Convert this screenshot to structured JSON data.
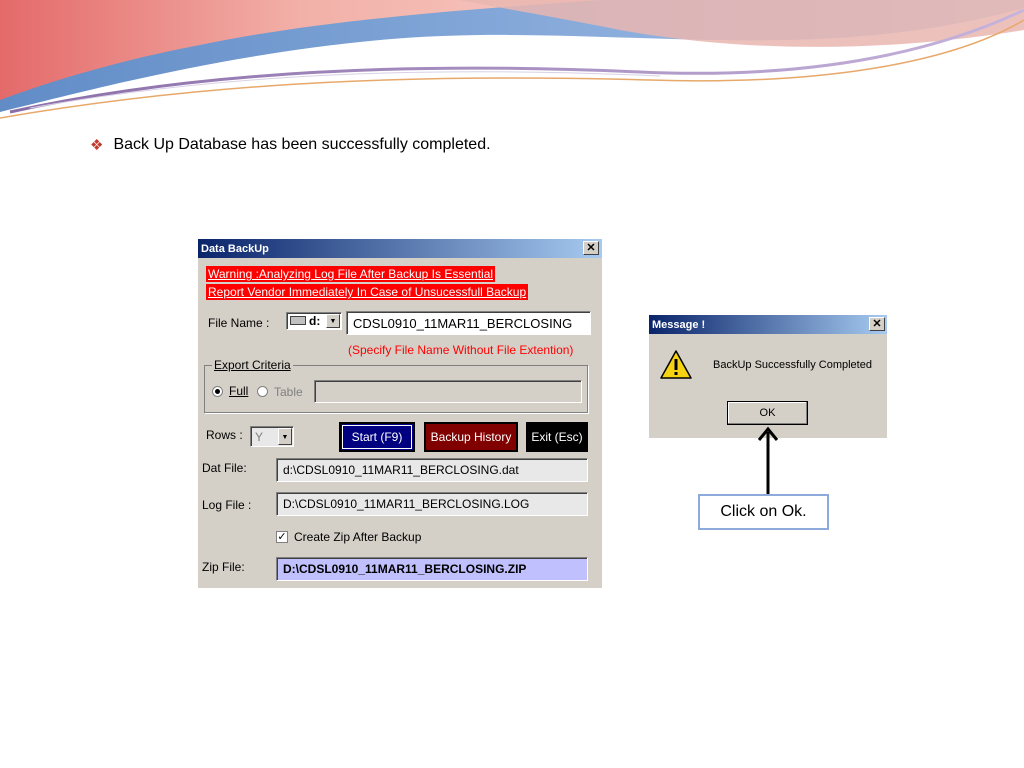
{
  "slide": {
    "bullet_text": "Back Up Database has been successfully completed.",
    "callout_text": "Click on Ok."
  },
  "backup_window": {
    "title": "Data BackUp",
    "warning_line1": "Warning :Analyzing Log File After Backup Is Essential",
    "warning_line2": "Report Vendor Immediately In Case of Unsucessfull Backup",
    "file_name_label": "File Name :",
    "drive": "d:",
    "file_name_value": "CDSL0910_11MAR11_BERCLOSING",
    "file_name_hint": "(Specify File Name Without File Extention)",
    "export_criteria_label": "Export Criteria",
    "full_label": "Full",
    "table_label": "Table",
    "rows_label": "Rows :",
    "rows_value": "Y",
    "start_button": "Start (F9)",
    "history_button": "Backup History",
    "exit_button": "Exit (Esc)",
    "dat_file_label": "Dat File:",
    "dat_file_value": "d:\\CDSL0910_11MAR11_BERCLOSING.dat",
    "log_file_label": "Log File :",
    "log_file_value": "D:\\CDSL0910_11MAR11_BERCLOSING.LOG",
    "create_zip_label": "Create Zip After Backup",
    "create_zip_checked": true,
    "zip_file_label": "Zip File:",
    "zip_file_value": "D:\\CDSL0910_11MAR11_BERCLOSING.ZIP",
    "close_glyph": "✕"
  },
  "message_box": {
    "title": "Message !",
    "text": "BackUp Successfully Completed",
    "ok_button": "OK",
    "icon": "warning-icon",
    "close_glyph": "✕"
  },
  "colors": {
    "title_start": "#0a246a",
    "title_end": "#a6caf0",
    "warning_bg": "#ff0000",
    "start_bg": "#000080",
    "history_bg": "#800000",
    "exit_bg": "#000000",
    "zip_bg": "#c0c0ff",
    "bullet": "#c0392b",
    "callout_border": "#8eaadb"
  }
}
